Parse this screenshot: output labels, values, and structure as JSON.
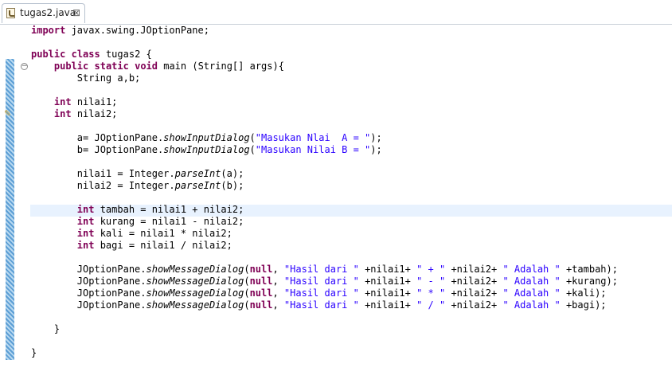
{
  "tab": {
    "label": "tugas2.java",
    "close": "⊠",
    "icon": "java-file-icon"
  },
  "colors": {
    "keyword": "#7f0055",
    "string": "#2a00ff",
    "current_line": "#e8f2fe",
    "change_bar": "#5d9fd5"
  },
  "code": {
    "l1": [
      "import",
      " javax.swing.JOptionPane;"
    ],
    "l3": [
      "public",
      " ",
      "class",
      " tugas2 {"
    ],
    "l4": [
      "    ",
      "public",
      " ",
      "static",
      " ",
      "void",
      " main (String[] args){"
    ],
    "l5": "        String a,b;",
    "l7": [
      "    ",
      "int",
      " nilai1;"
    ],
    "l8": [
      "    ",
      "int",
      " nilai2;"
    ],
    "l10": [
      "        a= JOptionPane.",
      "showInputDialog",
      "(",
      "\"Masukan Nlai  A = \"",
      ");"
    ],
    "l11": [
      "        b= JOptionPane.",
      "showInputDialog",
      "(",
      "\"Masukan Nilai B = \"",
      ");"
    ],
    "l13": [
      "        nilai1 = Integer.",
      "parseInt",
      "(a);"
    ],
    "l14": [
      "        nilai2 = Integer.",
      "parseInt",
      "(b);"
    ],
    "l16": [
      "        ",
      "int",
      " tambah = nilai1 + nilai2;"
    ],
    "l17": [
      "        ",
      "int",
      " kurang = nilai1 - nilai2;"
    ],
    "l18": [
      "        ",
      "int",
      " kali = nilai1 * nilai2;"
    ],
    "l19": [
      "        ",
      "int",
      " bagi = nilai1 / nilai2;"
    ],
    "l21": [
      "        JOptionPane.",
      "showMessageDialog",
      "(",
      "null",
      ", ",
      "\"Hasil dari \"",
      " +nilai1+ ",
      "\" + \"",
      " +nilai2+ ",
      "\" Adalah \"",
      " +tambah);"
    ],
    "l22": [
      "        JOptionPane.",
      "showMessageDialog",
      "(",
      "null",
      ", ",
      "\"Hasil dari \"",
      " +nilai1+ ",
      "\" - \"",
      " +nilai2+ ",
      "\" Adalah \"",
      " +kurang);"
    ],
    "l23": [
      "        JOptionPane.",
      "showMessageDialog",
      "(",
      "null",
      ", ",
      "\"Hasil dari \"",
      " +nilai1+ ",
      "\" * \"",
      " +nilai2+ ",
      "\" Adalah \"",
      " +kali);"
    ],
    "l24": [
      "        JOptionPane.",
      "showMessageDialog",
      "(",
      "null",
      ", ",
      "\"Hasil dari \"",
      " +nilai1+ ",
      "\" / \"",
      " +nilai2+ ",
      "\" Adalah \"",
      " +bagi);"
    ],
    "l26": "    }",
    "l28": "}"
  }
}
